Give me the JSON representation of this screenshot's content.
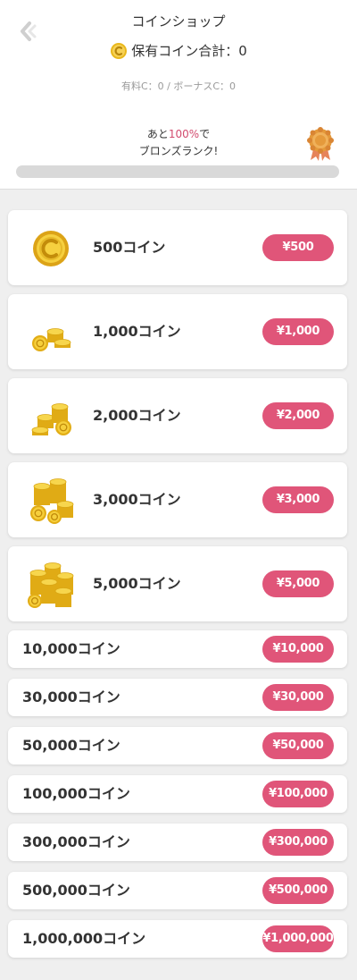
{
  "header": {
    "title": "コインショップ",
    "holdings_label": "保有コイン合計：0",
    "breakdown": "有料C：0 / ボーナスC：0",
    "rank_prefix": "あと",
    "rank_percent": "100%",
    "rank_suffix": "で",
    "rank_line2": "ブロンズランク!",
    "progress_fraction": 0.0,
    "accent_color": "#e05579"
  },
  "products_big": [
    {
      "label": "500コイン",
      "price": "¥500",
      "icon": "single-coin-icon"
    },
    {
      "label": "1,000コイン",
      "price": "¥1,000",
      "icon": "coin-stack-small-icon"
    },
    {
      "label": "2,000コイン",
      "price": "¥2,000",
      "icon": "coin-stack-medium-icon"
    },
    {
      "label": "3,000コイン",
      "price": "¥3,000",
      "icon": "coin-stack-large-icon"
    },
    {
      "label": "5,000コイン",
      "price": "¥5,000",
      "icon": "coin-pile-icon"
    }
  ],
  "products_small": [
    {
      "label": "10,000コイン",
      "price": "¥10,000"
    },
    {
      "label": "30,000コイン",
      "price": "¥30,000"
    },
    {
      "label": "50,000コイン",
      "price": "¥50,000"
    },
    {
      "label": "100,000コイン",
      "price": "¥100,000"
    },
    {
      "label": "300,000コイン",
      "price": "¥300,000"
    },
    {
      "label": "500,000コイン",
      "price": "¥500,000"
    },
    {
      "label": "1,000,000コイン",
      "price": "¥1,000,000"
    }
  ]
}
